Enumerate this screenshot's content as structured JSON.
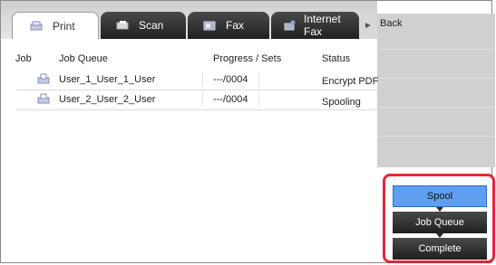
{
  "tabs": [
    {
      "label": "Print",
      "icon": "printer-icon",
      "active": true
    },
    {
      "label": "Scan",
      "icon": "scan-icon",
      "active": false
    },
    {
      "label": "Fax",
      "icon": "fax-icon",
      "active": false
    },
    {
      "label": "Internet Fax",
      "icon": "internet-fax-icon",
      "active": false
    }
  ],
  "right_panel": {
    "back_label": "Back"
  },
  "table": {
    "headers": {
      "job": "Job",
      "job_queue": "Job Queue",
      "progress": "Progress / Sets",
      "status": "Status"
    },
    "rows": [
      {
        "name": "User_1_User_1_User",
        "progress": "---/0004",
        "status": "Encrypt PDF"
      },
      {
        "name": "User_2_User_2_User",
        "progress": "---/0004",
        "status": "Spooling"
      }
    ]
  },
  "status_buttons": [
    {
      "label": "Spool",
      "active": true
    },
    {
      "label": "Job Queue",
      "active": false
    },
    {
      "label": "Complete",
      "active": false
    }
  ],
  "colors": {
    "accent": "#5f9ff2",
    "highlight_border": "#e0283a",
    "tab_dark": "#2a2a2a"
  }
}
